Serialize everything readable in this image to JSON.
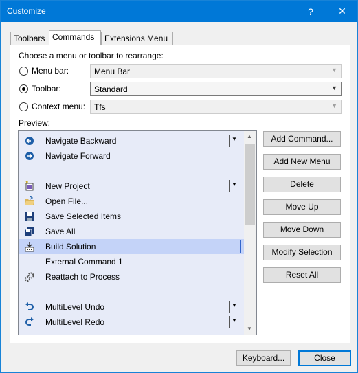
{
  "window": {
    "title": "Customize",
    "help": "?",
    "close": "✕"
  },
  "tabs": [
    {
      "label": "Toolbars"
    },
    {
      "label": "Commands"
    },
    {
      "label": "Extensions Menu"
    }
  ],
  "instruction": "Choose a menu or toolbar to rearrange:",
  "options": [
    {
      "label": "Menu bar:",
      "value": "Menu Bar",
      "selected": false,
      "enabled": false
    },
    {
      "label": "Toolbar:",
      "value": "Standard",
      "selected": true,
      "enabled": true
    },
    {
      "label": "Context menu:",
      "value": "Tfs",
      "selected": false,
      "enabled": false
    }
  ],
  "preview_label": "Preview:",
  "commands": [
    {
      "label": "Navigate Backward",
      "icon": "arrow-left-circle-icon",
      "dropdown": true
    },
    {
      "label": "Navigate Forward",
      "icon": "arrow-right-circle-icon",
      "dropdown": false
    },
    {
      "label": "New Project",
      "icon": "new-project-icon",
      "dropdown": true
    },
    {
      "label": "Open File...",
      "icon": "open-folder-icon",
      "dropdown": false
    },
    {
      "label": "Save Selected Items",
      "icon": "save-icon",
      "dropdown": false
    },
    {
      "label": "Save All",
      "icon": "save-all-icon",
      "dropdown": false
    },
    {
      "label": "Build Solution",
      "icon": "build-solution-icon",
      "dropdown": false,
      "selected": true
    },
    {
      "label": "External Command 1",
      "icon": "",
      "dropdown": false
    },
    {
      "label": "Reattach to Process",
      "icon": "gears-icon",
      "dropdown": false
    },
    {
      "label": "MultiLevel Undo",
      "icon": "undo-icon",
      "dropdown": true
    },
    {
      "label": "MultiLevel Redo",
      "icon": "redo-icon",
      "dropdown": true
    }
  ],
  "buttons": {
    "add_command": "Add Command...",
    "add_new_menu": "Add New Menu",
    "delete": "Delete",
    "move_up": "Move Up",
    "move_down": "Move Down",
    "modify_selection": "Modify Selection",
    "reset_all": "Reset All",
    "keyboard": "Keyboard...",
    "close": "Close"
  },
  "colors": {
    "titlebar": "#0078d7",
    "preview_bg": "#e7ebf8",
    "selection": "#c4d3f8",
    "icon_blue": "#1e5fa8"
  }
}
